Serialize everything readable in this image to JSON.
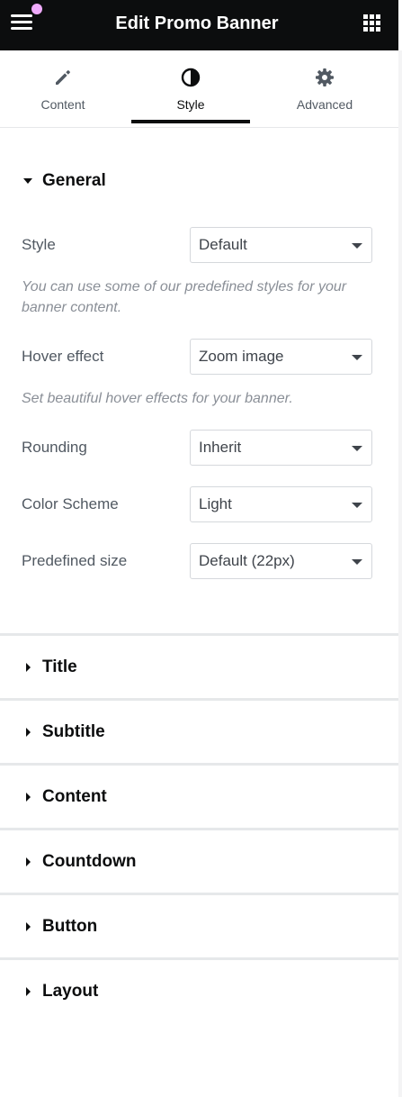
{
  "header": {
    "title": "Edit Promo Banner",
    "menu_icon": "hamburger-icon",
    "apps_icon": "grid-icon"
  },
  "tabs": [
    {
      "label": "Content",
      "icon": "pencil-icon"
    },
    {
      "label": "Style",
      "icon": "half-circle-icon",
      "active": true
    },
    {
      "label": "Advanced",
      "icon": "gear-icon"
    }
  ],
  "general": {
    "title": "General",
    "fields": [
      {
        "label": "Style",
        "value": "Default"
      },
      {
        "label": "Hover effect",
        "value": "Zoom image"
      },
      {
        "label": "Rounding",
        "value": "Inherit"
      },
      {
        "label": "Color Scheme",
        "value": "Light"
      },
      {
        "label": "Predefined size",
        "value": "Default (22px)"
      }
    ],
    "help_style": "You can use some of our predefined styles for your banner content.",
    "help_hover": "Set beautiful hover effects for your banner."
  },
  "sections": [
    "Title",
    "Subtitle",
    "Content",
    "Countdown",
    "Button",
    "Layout"
  ],
  "colors": {
    "header_bg": "#0c0d0e",
    "notification_dot": "#f0abfc",
    "muted_text": "#515962",
    "help_text": "#8a8f97"
  }
}
